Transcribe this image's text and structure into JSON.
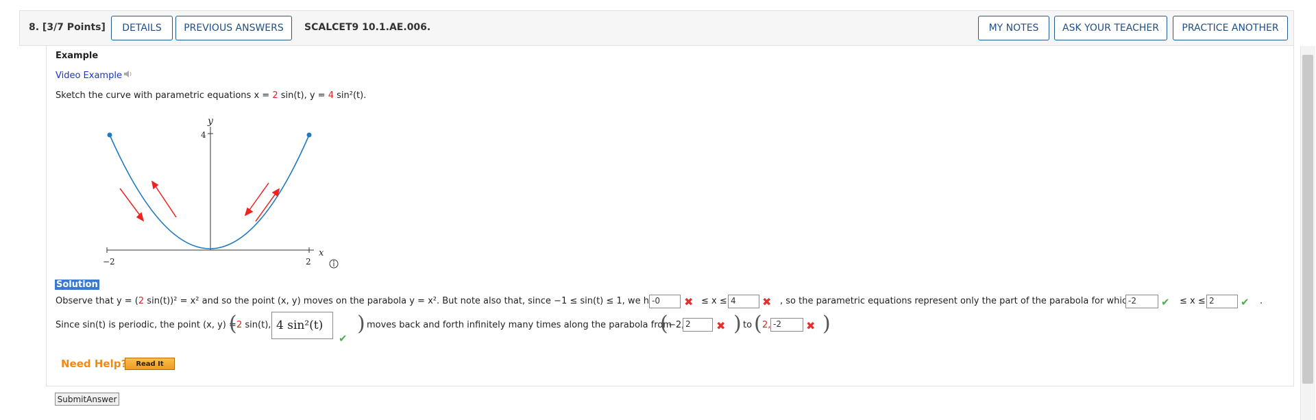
{
  "header": {
    "question_number": "8. [3/7 Points]",
    "details_label": "DETAILS",
    "previous_answers_label": "PREVIOUS ANSWERS",
    "problem_code": "SCALCET9 10.1.AE.006.",
    "my_notes_label": "MY NOTES",
    "ask_teacher_label": "ASK YOUR TEACHER",
    "practice_another_label": "PRACTICE ANOTHER"
  },
  "example": {
    "heading": "Example",
    "video_link": "Video Example",
    "prompt_prefix": "Sketch the curve with parametric equations x = ",
    "x_coef": "2",
    "prompt_mid": " sin(t), y = ",
    "y_coef": "4",
    "prompt_suffix": " sin²(t)."
  },
  "graph": {
    "y_axis_label": "y",
    "x_axis_label": "x",
    "y_tick": "4",
    "x_tick_neg": "−2",
    "x_tick_pos": "2"
  },
  "solution": {
    "label": "Solution",
    "line1_a": "Observe that y = (",
    "line1_coef": "2",
    "line1_b": " sin(t))² = x² and so the point (x, y) moves on the parabola y = x². But note also that, since −1 ≤ sin(t) ≤ 1, we have",
    "input_lower1": "-0",
    "le_x_le": "≤ x ≤",
    "input_upper1": "4",
    "line1_c": ", so the parametric equations represent only the part of the parabola for which",
    "input_lower2": "-2",
    "le_x_le2": "≤ x ≤",
    "input_upper2": "2",
    "line1_end": ".",
    "line2_a": "Since sin(t) is periodic, the point (x, y) =",
    "line2_coef": "2",
    "line2_b": " sin(t),",
    "big_answer": "4 sin²(t)",
    "line2_c": "moves back and forth infinitely many times along the parabola from",
    "from_x": "−2,",
    "input_from_y": "2",
    "to_word": "to",
    "to_x": "2,",
    "input_to_y": "-2"
  },
  "help": {
    "need_help": "Need Help?",
    "read_it": "Read It"
  },
  "submit_label": "SubmitAnswer",
  "colors": {
    "accent": "#1f4f86",
    "curve": "#1f7bc0",
    "arrow": "#ee2222",
    "wrong": "#e23030",
    "correct": "#4caf50",
    "help": "#f08a12"
  }
}
